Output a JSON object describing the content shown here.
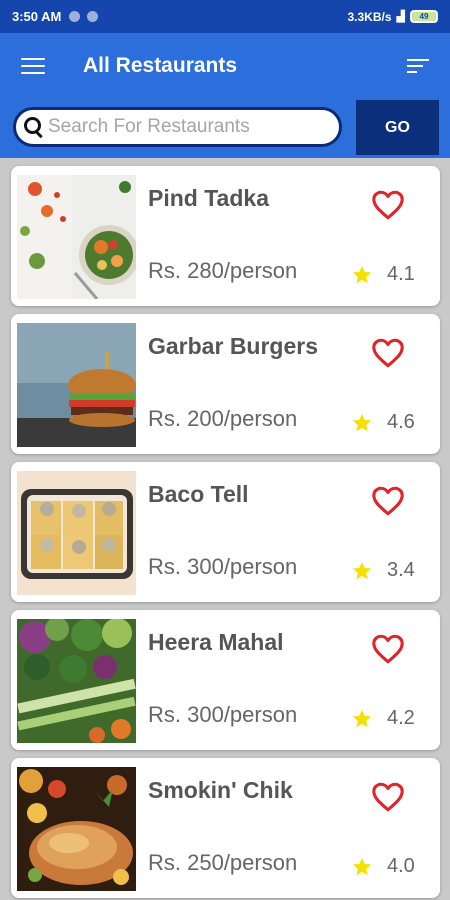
{
  "status": {
    "time": "3:50 AM",
    "speed": "3.3KB/s",
    "battery": "49"
  },
  "app": {
    "title": "All Restaurants"
  },
  "search": {
    "placeholder": "Search For Restaurants",
    "go_label": "GO"
  },
  "restaurants": [
    {
      "name": "Pind Tadka",
      "price": "Rs. 280/person",
      "rating": "4.1"
    },
    {
      "name": "Garbar Burgers",
      "price": "Rs. 200/person",
      "rating": "4.6"
    },
    {
      "name": "Baco Tell",
      "price": "Rs. 300/person",
      "rating": "3.4"
    },
    {
      "name": "Heera Mahal",
      "price": "Rs. 300/person",
      "rating": "4.2"
    },
    {
      "name": "Smokin' Chik",
      "price": "Rs. 250/person",
      "rating": "4.0"
    }
  ],
  "colors": {
    "app_bar": "#2c6fdc",
    "status_bar": "#1546ad",
    "go_button": "#0c2f7c",
    "heart": "#e0242b",
    "star": "#f5e000"
  },
  "icons": {
    "menu": "hamburger-menu-icon",
    "sort": "sort-icon",
    "search": "search-icon",
    "favorite": "heart-outline-icon",
    "rating": "star-icon"
  }
}
